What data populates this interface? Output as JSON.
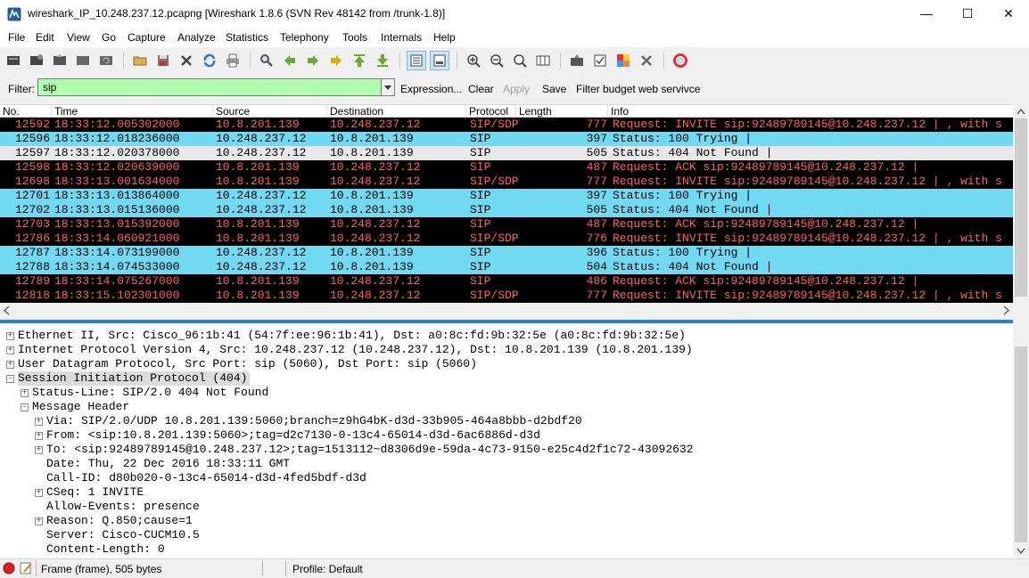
{
  "window": {
    "title": "wireshark_IP_10.248.237.12.pcapng  [Wireshark 1.8.6  (SVN Rev 48142 from /trunk-1.8)]",
    "minimize_icon": "minimize-icon",
    "maximize_icon": "maximize-icon",
    "close_icon": "close-icon"
  },
  "menu": [
    "File",
    "Edit",
    "View",
    "Go",
    "Capture",
    "Analyze",
    "Statistics",
    "Telephony",
    "Tools",
    "Internals",
    "Help"
  ],
  "toolbar": {
    "icons": [
      "interface-list-icon",
      "capture-options-icon",
      "start-capture-icon",
      "stop-capture-icon",
      "restart-capture-icon",
      "open-file-icon",
      "save-file-icon",
      "close-file-icon",
      "reload-icon",
      "print-icon",
      "find-packet-icon",
      "go-back-icon",
      "go-forward-icon",
      "go-to-packet-icon",
      "go-first-icon",
      "go-last-icon",
      "colorize-icon",
      "auto-scroll-icon",
      "zoom-in-icon",
      "zoom-out-icon",
      "normal-size-icon",
      "resize-columns-icon",
      "capture-filters-icon",
      "display-filters-icon",
      "coloring-rules-icon",
      "preferences-icon",
      "help-icon"
    ]
  },
  "filter": {
    "label": "Filter:",
    "value": "sip",
    "expression": "Expression...",
    "clear": "Clear",
    "apply": "Apply",
    "save": "Save",
    "saved_filter": "Filter budget web servivce"
  },
  "packet_list": {
    "columns": [
      "No.",
      "Time",
      "Source",
      "Destination",
      "Protocol",
      "Length",
      "Info"
    ],
    "rows": [
      {
        "no": "12592",
        "time": "18:33:12.005302000",
        "src": "10.8.201.139",
        "dst": "10.248.237.12",
        "proto": "SIP/SDP",
        "len": "777",
        "info": "Request: INVITE sip:92489789145@10.248.237.12 | , with s",
        "kind": "invite"
      },
      {
        "no": "12596",
        "time": "18:33:12.018236000",
        "src": "10.248.237.12",
        "dst": "10.8.201.139",
        "proto": "SIP",
        "len": "397",
        "info": "Status: 100 Trying |",
        "kind": "status-trying"
      },
      {
        "no": "12597",
        "time": "18:33:12.020378000",
        "src": "10.248.237.12",
        "dst": "10.8.201.139",
        "proto": "SIP",
        "len": "505",
        "info": "Status: 404 Not Found |",
        "kind": "selected"
      },
      {
        "no": "12598",
        "time": "18:33:12.020639000",
        "src": "10.8.201.139",
        "dst": "10.248.237.12",
        "proto": "SIP",
        "len": "487",
        "info": "Request: ACK sip:92489789145@10.248.237.12 |",
        "kind": "ack"
      },
      {
        "no": "12698",
        "time": "18:33:13.001634000",
        "src": "10.8.201.139",
        "dst": "10.248.237.12",
        "proto": "SIP/SDP",
        "len": "777",
        "info": "Request: INVITE sip:92489789145@10.248.237.12 | , with s",
        "kind": "invite"
      },
      {
        "no": "12701",
        "time": "18:33:13.013864000",
        "src": "10.248.237.12",
        "dst": "10.8.201.139",
        "proto": "SIP",
        "len": "397",
        "info": "Status: 100 Trying |",
        "kind": "status-trying"
      },
      {
        "no": "12702",
        "time": "18:33:13.015136000",
        "src": "10.248.237.12",
        "dst": "10.8.201.139",
        "proto": "SIP",
        "len": "505",
        "info": "Status: 404 Not Found |",
        "kind": "status-notfound"
      },
      {
        "no": "12703",
        "time": "18:33:13.015392000",
        "src": "10.8.201.139",
        "dst": "10.248.237.12",
        "proto": "SIP",
        "len": "487",
        "info": "Request: ACK sip:92489789145@10.248.237.12 |",
        "kind": "ack"
      },
      {
        "no": "12786",
        "time": "18:33:14.060921000",
        "src": "10.8.201.139",
        "dst": "10.248.237.12",
        "proto": "SIP/SDP",
        "len": "776",
        "info": "Request: INVITE sip:92489789145@10.248.237.12 | , with s",
        "kind": "invite"
      },
      {
        "no": "12787",
        "time": "18:33:14.073199000",
        "src": "10.248.237.12",
        "dst": "10.8.201.139",
        "proto": "SIP",
        "len": "396",
        "info": "Status: 100 Trying |",
        "kind": "status-trying"
      },
      {
        "no": "12788",
        "time": "18:33:14.074533000",
        "src": "10.248.237.12",
        "dst": "10.8.201.139",
        "proto": "SIP",
        "len": "504",
        "info": "Status: 404 Not Found |",
        "kind": "status-notfound"
      },
      {
        "no": "12789",
        "time": "18:33:14.075267000",
        "src": "10.8.201.139",
        "dst": "10.248.237.12",
        "proto": "SIP",
        "len": "486",
        "info": "Request: ACK sip:92489789145@10.248.237.12 |",
        "kind": "ack"
      },
      {
        "no": "12818",
        "time": "18:33:15.102301000",
        "src": "10.8.201.139",
        "dst": "10.248.237.12",
        "proto": "SIP/SDP",
        "len": "777",
        "info": "Request: INVITE sip:92489789145@10.248.237.12 | , with s",
        "kind": "invite"
      }
    ]
  },
  "details": [
    {
      "text": "Ethernet II, Src: Cisco_96:1b:41 (54:7f:ee:96:1b:41), Dst: a0:8c:fd:9b:32:5e (a0:8c:fd:9b:32:5e)",
      "level": 0,
      "exp": "+",
      "hl": false
    },
    {
      "text": "Internet Protocol Version 4, Src: 10.248.237.12 (10.248.237.12), Dst: 10.8.201.139 (10.8.201.139)",
      "level": 0,
      "exp": "+",
      "hl": false
    },
    {
      "text": "User Datagram Protocol, Src Port: sip (5060), Dst Port: sip (5060)",
      "level": 0,
      "exp": "+",
      "hl": false
    },
    {
      "text": "Session Initiation Protocol (404)",
      "level": 0,
      "exp": "-",
      "hl": true
    },
    {
      "text": "Status-Line: SIP/2.0 404 Not Found",
      "level": 1,
      "exp": "+",
      "hl": false
    },
    {
      "text": "Message Header",
      "level": 1,
      "exp": "-",
      "hl": false
    },
    {
      "text": "Via: SIP/2.0/UDP 10.8.201.139:5060;branch=z9hG4bK-d3d-33b905-464a8bbb-d2bdf20",
      "level": 2,
      "exp": "+",
      "hl": false
    },
    {
      "text": "From: <sip:10.8.201.139:5060>;tag=d2c7130-0-13c4-65014-d3d-6ac6886d-d3d",
      "level": 2,
      "exp": "+",
      "hl": false
    },
    {
      "text": "To: <sip:92489789145@10.248.237.12>;tag=1513112~d8306d9e-59da-4c73-9150-e25c4d2f1c72-43092632",
      "level": 2,
      "exp": "+",
      "hl": false
    },
    {
      "text": "Date: Thu, 22 Dec 2016 18:33:11 GMT",
      "level": 2,
      "exp": "",
      "hl": false
    },
    {
      "text": "Call-ID: d80b020-0-13c4-65014-d3d-4fed5bdf-d3d",
      "level": 2,
      "exp": "",
      "hl": false
    },
    {
      "text": "CSeq: 1 INVITE",
      "level": 2,
      "exp": "+",
      "hl": false
    },
    {
      "text": "Allow-Events: presence",
      "level": 2,
      "exp": "",
      "hl": false
    },
    {
      "text": "Reason: Q.850;cause=1",
      "level": 2,
      "exp": "+",
      "hl": false
    },
    {
      "text": "Server: Cisco-CUCM10.5",
      "level": 2,
      "exp": "",
      "hl": false
    },
    {
      "text": "Content-Length: 0",
      "level": 2,
      "exp": "",
      "hl": false
    }
  ],
  "status": {
    "frame": "Frame (frame), 505 bytes",
    "profile": "Profile: Default"
  }
}
